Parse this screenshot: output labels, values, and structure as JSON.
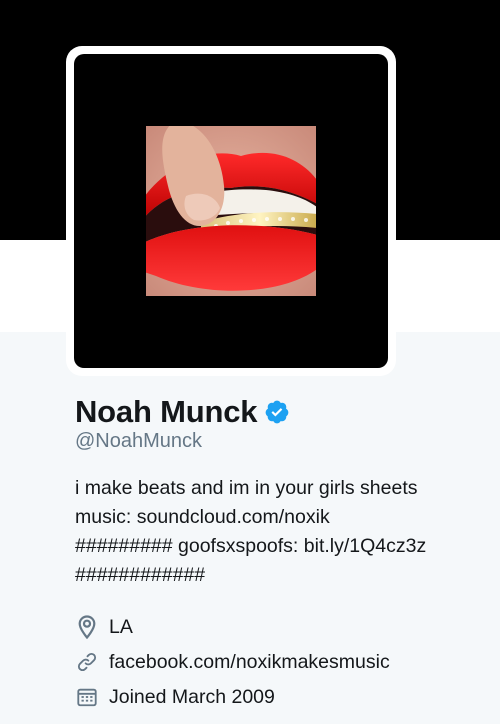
{
  "profile": {
    "display_name": "Noah Munck",
    "handle": "@NoahMunck",
    "verified": true,
    "bio": {
      "line1": "i make beats and im in your girls sheets",
      "line2_prefix": "music: ",
      "line2_link": "soundcloud.com/noxik",
      "line3_prefix": "######### goofsxspoofs: ",
      "line3_link": "bit.ly/1Q4cz3z",
      "line4": "############"
    },
    "location": "LA",
    "website": "facebook.com/noxikmakesmusic",
    "joined": "Joined March 2009"
  },
  "icons": {
    "verified": "verified-badge-icon",
    "location": "map-pin-icon",
    "website": "link-icon",
    "joined": "calendar-icon"
  },
  "colors": {
    "header_bg": "#000000",
    "profile_bg": "#f5f8fa",
    "text": "#14171a",
    "secondary_text": "#657786",
    "verified_blue": "#1da1f2",
    "icon_gray": "#657786"
  }
}
